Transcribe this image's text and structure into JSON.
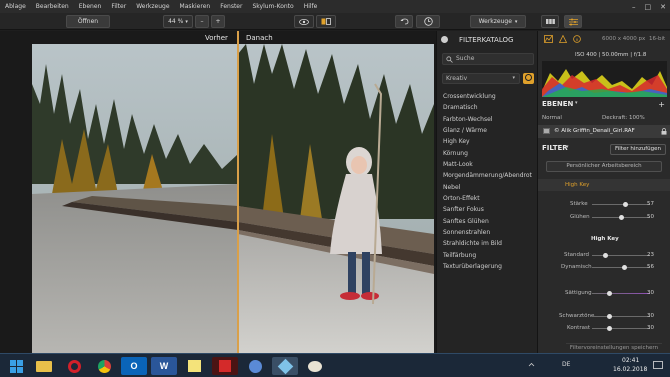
{
  "menu": [
    "Ablage",
    "Bearbeiten",
    "Ebenen",
    "Filter",
    "Werkzeuge",
    "Maskieren",
    "Fenster",
    "Skylum-Konto",
    "Hilfe"
  ],
  "window_controls": [
    "–",
    "□",
    "✕"
  ],
  "toolbar": {
    "open_label": "Öffnen",
    "zoom": "44 %",
    "zoom_caret": "▾",
    "zoom_out": "–",
    "zoom_in": "+",
    "tools_label": "Werkzeuge"
  },
  "canvas": {
    "before_label": "Vorher",
    "after_label": "Danach"
  },
  "catalog": {
    "title": "FILTERKATALOG",
    "search_placeholder": "Suche",
    "category": "Kreativ",
    "filters": [
      "Crossentwicklung",
      "Dramatisch",
      "Farbton-Wechsel",
      "Glanz / Wärme",
      "High Key",
      "Körnung",
      "Matt-Look",
      "Morgendämmerung/Abendrot",
      "Nebel",
      "Orton-Effekt",
      "Sanfter Fokus",
      "Sanftes Glühen",
      "Sonnenstrahlen",
      "Strahldichte im Bild",
      "Teilfärbung",
      "Texturüberlagerung"
    ]
  },
  "panel": {
    "image_size": "6000 x 4000 px",
    "bit_depth": "16-bit",
    "exif": "ISO 400 | 50.00mm | f/1.8",
    "layers_title": "EBENEN",
    "blend_mode": "Normal",
    "opacity_label": "Deckraft: 100%",
    "layer_name": "© Alik Griffin_Denali_Girl.RAF",
    "filter_title": "FILTER",
    "add_filter": "Filter hinzufügen",
    "workspace": "Persönlicher Arbeitsbereich",
    "section_high_key": "High Key",
    "section_title": "High Key",
    "presets_save": "Filtervoreinstellungen speichern",
    "sliders": [
      {
        "label": "Stärke",
        "value": "57",
        "level": 0.57
      },
      {
        "label": "Glühen",
        "value": "50",
        "level": 0.5
      },
      {
        "label": "Standard",
        "value": "23",
        "level": 0.23
      },
      {
        "label": "Dynamisch",
        "value": "56",
        "level": 0.56
      },
      {
        "label": "Sättigung",
        "value": "30",
        "level": 0.3
      },
      {
        "label": "Schwarztöne",
        "value": "30",
        "level": 0.3
      },
      {
        "label": "Kontrast",
        "value": "30",
        "level": 0.3
      }
    ]
  },
  "taskbar": {
    "lang": "DE",
    "time": "02:41",
    "date": "16.02.2018",
    "icons": [
      "windows-start",
      "file-explorer",
      "opera",
      "chrome",
      "outlook",
      "word",
      "sticky-notes",
      "acrobat",
      "media-player",
      "luminar",
      "paint"
    ]
  },
  "colors": {
    "accent": "#e0a12b",
    "taskbar": "#1b2838",
    "panel": "#2a2a2a"
  }
}
